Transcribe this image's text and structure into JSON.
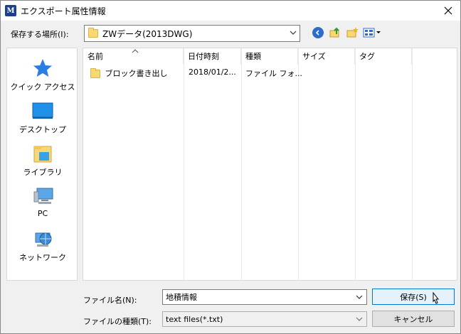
{
  "window": {
    "title": "エクスポート属性情報",
    "app_icon_text": "M"
  },
  "location": {
    "label": "保存する場所(I):",
    "value": "ZWデータ(2013DWG)"
  },
  "toolbar": {
    "icons": [
      "back-icon",
      "up-folder-icon",
      "new-folder-icon",
      "view-menu-icon"
    ]
  },
  "sidebar": {
    "items": [
      {
        "label": "クイック アクセス",
        "icon": "star-icon"
      },
      {
        "label": "デスクトップ",
        "icon": "desktop-icon"
      },
      {
        "label": "ライブラリ",
        "icon": "library-icon"
      },
      {
        "label": "PC",
        "icon": "pc-icon"
      },
      {
        "label": "ネットワーク",
        "icon": "network-icon"
      }
    ]
  },
  "filelist": {
    "columns": [
      "名前",
      "日付時刻",
      "種類",
      "サイズ",
      "タグ"
    ],
    "rows": [
      {
        "name": "ブロック書き出し",
        "date": "2018/01/2...",
        "type": "ファイル フォ...",
        "size": "",
        "tags": ""
      }
    ]
  },
  "filename": {
    "label": "ファイル名(N):",
    "value": "地積情報"
  },
  "filetype": {
    "label": "ファイルの種類(T):",
    "value": "text files(*.txt)"
  },
  "buttons": {
    "save": "保存(S)",
    "cancel": "キャンセル"
  },
  "colors": {
    "accent": "#0078d7",
    "folder": "#f8d775"
  }
}
